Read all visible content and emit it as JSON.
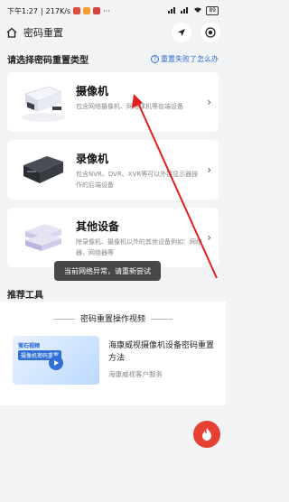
{
  "status_bar": {
    "time": "下午1:27",
    "speed": "217K/s",
    "battery": "89"
  },
  "header": {
    "title": "密码重置"
  },
  "section": {
    "title": "请选择密码重置类型",
    "help": "重置失败了怎么办"
  },
  "devices": [
    {
      "title": "摄像机",
      "desc": "包含网络摄像机、网络球机等前端设备"
    },
    {
      "title": "录像机",
      "desc": "包含NVR、DVR、XVR等可以外接显示器操作的后端设备"
    },
    {
      "title": "其他设备",
      "desc": "除录像机、摄像机以外的其他设备例如：网络器、网络器等"
    }
  ],
  "toast": "当前网络异常，请重新尝试",
  "tools": {
    "title": "推荐工具",
    "video_section_title": "密码重置操作视频",
    "video": {
      "badge": "萤石视频",
      "thumb_text": "摄像机密码重置",
      "name": "海康威视摄像机设备密码重置方法",
      "source": "海康威视客户服务"
    }
  },
  "colors": {
    "accent": "#2f6fd6",
    "fab": "#e64033",
    "annotation_arrow": "#e02020"
  }
}
